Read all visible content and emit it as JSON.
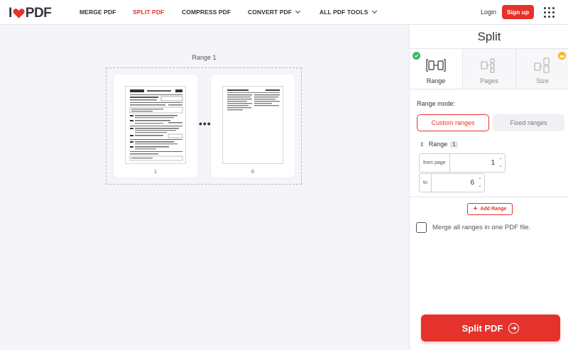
{
  "header": {
    "logo_text": "PDF",
    "nav": [
      {
        "label": "MERGE PDF",
        "active": false
      },
      {
        "label": "SPLIT PDF",
        "active": true
      },
      {
        "label": "COMPRESS PDF",
        "active": false
      },
      {
        "label": "CONVERT PDF",
        "dropdown": true
      },
      {
        "label": "ALL PDF TOOLS",
        "dropdown": true
      }
    ],
    "login_label": "Login",
    "signup_label": "Sign up",
    "menu_icon": "apps-grid-icon"
  },
  "workspace": {
    "range_title": "Range 1",
    "pages": [
      {
        "number": "1"
      },
      {
        "number": "6"
      }
    ],
    "ellipsis": "•••"
  },
  "sidebar": {
    "title": "Split",
    "tabs": [
      {
        "label": "Range",
        "active": true,
        "icon": "range-split-icon",
        "badge": "check-icon"
      },
      {
        "label": "Pages",
        "active": false,
        "icon": "pages-split-icon"
      },
      {
        "label": "Size",
        "active": false,
        "icon": "size-split-icon",
        "badge": "crown-icon"
      }
    ],
    "range_mode_label": "Range mode:",
    "mode_options": [
      "Custom ranges",
      "Fixed ranges"
    ],
    "range_label": "Range",
    "range_index": "1",
    "from_label": "from page",
    "from_value": "1",
    "to_label": "to",
    "to_value": "6",
    "add_range_label": "Add Range",
    "merge_label": "Merge all ranges in one PDF file.",
    "split_button_label": "Split PDF"
  },
  "colors": {
    "brand_red": "#e5322d",
    "success_green": "#3fb86a",
    "crown_gold": "#f5b51c"
  }
}
